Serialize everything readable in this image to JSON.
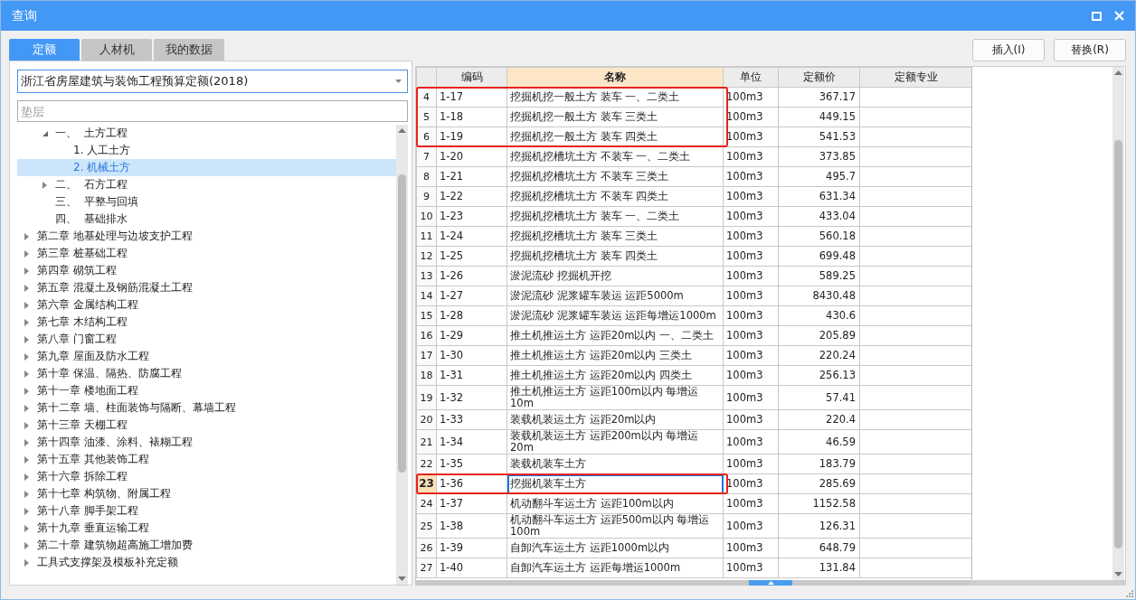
{
  "window": {
    "title": "查询"
  },
  "tabs": [
    {
      "label": "定额",
      "selected": true
    },
    {
      "label": "人材机",
      "selected": false
    },
    {
      "label": "我的数据",
      "selected": false
    }
  ],
  "library_select": {
    "value": "浙江省房屋建筑与装饰工程预算定额(2018)"
  },
  "search": {
    "placeholder": "垫层"
  },
  "tree": {
    "items": [
      {
        "kind": "section",
        "label": "一、  土方工程",
        "expanded": true,
        "selected": false,
        "children": [
          {
            "label": "1. 人工土方",
            "selected": false
          },
          {
            "label": "2. 机械土方",
            "selected": true
          }
        ]
      },
      {
        "kind": "section",
        "label": "二、  石方工程",
        "expanded": false,
        "selected": false
      },
      {
        "kind": "section",
        "label": "三、  平整与回填",
        "selected": false
      },
      {
        "kind": "section",
        "label": "四、  基础排水",
        "selected": false
      },
      {
        "kind": "chapter",
        "label": "第二章 地基处理与边坡支护工程",
        "expanded": false,
        "selected": false
      },
      {
        "kind": "chapter",
        "label": "第三章 桩基础工程",
        "expanded": false,
        "selected": false
      },
      {
        "kind": "chapter",
        "label": "第四章 砌筑工程",
        "expanded": false,
        "selected": false
      },
      {
        "kind": "chapter",
        "label": "第五章 混凝土及钢筋混凝土工程",
        "expanded": false,
        "selected": false
      },
      {
        "kind": "chapter",
        "label": "第六章 金属结构工程",
        "expanded": false,
        "selected": false
      },
      {
        "kind": "chapter",
        "label": "第七章 木结构工程",
        "expanded": false,
        "selected": false
      },
      {
        "kind": "chapter",
        "label": "第八章 门窗工程",
        "expanded": false,
        "selected": false
      },
      {
        "kind": "chapter",
        "label": "第九章 屋面及防水工程",
        "expanded": false,
        "selected": false
      },
      {
        "kind": "chapter",
        "label": "第十章 保温、隔热、防腐工程",
        "expanded": false,
        "selected": false
      },
      {
        "kind": "chapter",
        "label": "第十一章 楼地面工程",
        "expanded": false,
        "selected": false
      },
      {
        "kind": "chapter",
        "label": "第十二章 墙、柱面装饰与隔断、幕墙工程",
        "expanded": false,
        "selected": false
      },
      {
        "kind": "chapter",
        "label": "第十三章 天棚工程",
        "expanded": false,
        "selected": false
      },
      {
        "kind": "chapter",
        "label": "第十四章 油漆、涂料、裱糊工程",
        "expanded": false,
        "selected": false
      },
      {
        "kind": "chapter",
        "label": "第十五章 其他装饰工程",
        "expanded": false,
        "selected": false
      },
      {
        "kind": "chapter",
        "label": "第十六章 拆除工程",
        "expanded": false,
        "selected": false
      },
      {
        "kind": "chapter",
        "label": "第十七章 构筑物、附属工程",
        "expanded": false,
        "selected": false
      },
      {
        "kind": "chapter",
        "label": "第十八章 脚手架工程",
        "expanded": false,
        "selected": false
      },
      {
        "kind": "chapter",
        "label": "第十九章 垂直运输工程",
        "expanded": false,
        "selected": false
      },
      {
        "kind": "chapter",
        "label": "第二十章 建筑物超高施工增加费",
        "expanded": false,
        "selected": false
      },
      {
        "kind": "chapter",
        "label": "工具式支撑架及模板补充定额",
        "expanded": false,
        "selected": false
      }
    ]
  },
  "buttons": [
    "插入(I)",
    "替换(R)"
  ],
  "table": {
    "columns": [
      {
        "label": "编码",
        "selected": false
      },
      {
        "label": "名称",
        "selected": true
      },
      {
        "label": "单位",
        "selected": false
      },
      {
        "label": "定额价",
        "selected": false
      },
      {
        "label": "定额专业",
        "selected": false
      }
    ],
    "rows": [
      {
        "number": "4",
        "code": "1-17",
        "name": "挖掘机挖一般土方 装车 一、二类土",
        "unit": "100m3",
        "price": "367.17",
        "selected": false,
        "outlined": true
      },
      {
        "number": "5",
        "code": "1-18",
        "name": "挖掘机挖一般土方 装车 三类土",
        "unit": "100m3",
        "price": "449.15",
        "selected": false,
        "outlined": true
      },
      {
        "number": "6",
        "code": "1-19",
        "name": "挖掘机挖一般土方 装车 四类土",
        "unit": "100m3",
        "price": "541.53",
        "selected": false,
        "outlined": true
      },
      {
        "number": "7",
        "code": "1-20",
        "name": "挖掘机挖槽坑土方 不装车 一、二类土",
        "unit": "100m3",
        "price": "373.85",
        "selected": false,
        "outlined": false
      },
      {
        "number": "8",
        "code": "1-21",
        "name": "挖掘机挖槽坑土方 不装车 三类土",
        "unit": "100m3",
        "price": "495.7",
        "selected": false,
        "outlined": false
      },
      {
        "number": "9",
        "code": "1-22",
        "name": "挖掘机挖槽坑土方 不装车 四类土",
        "unit": "100m3",
        "price": "631.34",
        "selected": false,
        "outlined": false
      },
      {
        "number": "10",
        "code": "1-23",
        "name": "挖掘机挖槽坑土方 装车 一、二类土",
        "unit": "100m3",
        "price": "433.04",
        "selected": false,
        "outlined": false
      },
      {
        "number": "11",
        "code": "1-24",
        "name": "挖掘机挖槽坑土方 装车 三类土",
        "unit": "100m3",
        "price": "560.18",
        "selected": false,
        "outlined": false
      },
      {
        "number": "12",
        "code": "1-25",
        "name": "挖掘机挖槽坑土方 装车 四类土",
        "unit": "100m3",
        "price": "699.48",
        "selected": false,
        "outlined": false
      },
      {
        "number": "13",
        "code": "1-26",
        "name": "淤泥流砂 挖掘机开挖",
        "unit": "100m3",
        "price": "589.25",
        "selected": false,
        "outlined": false
      },
      {
        "number": "14",
        "code": "1-27",
        "name": "淤泥流砂 泥浆罐车装运 运距5000m",
        "unit": "100m3",
        "price": "8430.48",
        "selected": false,
        "outlined": false
      },
      {
        "number": "15",
        "code": "1-28",
        "name": "淤泥流砂 泥浆罐车装运 运距每增运1000m",
        "unit": "100m3",
        "price": "430.6",
        "selected": false,
        "outlined": false
      },
      {
        "number": "16",
        "code": "1-29",
        "name": "推土机推运土方 运距20m以内 一、二类土",
        "unit": "100m3",
        "price": "205.89",
        "selected": false,
        "outlined": false
      },
      {
        "number": "17",
        "code": "1-30",
        "name": "推土机推运土方 运距20m以内 三类土",
        "unit": "100m3",
        "price": "220.24",
        "selected": false,
        "outlined": false
      },
      {
        "number": "18",
        "code": "1-31",
        "name": "推土机推运土方 运距20m以内 四类土",
        "unit": "100m3",
        "price": "256.13",
        "selected": false,
        "outlined": false
      },
      {
        "number": "19",
        "code": "1-32",
        "name": "推土机推运土方 运距100m以内 每增运10m",
        "unit": "100m3",
        "price": "57.41",
        "selected": false,
        "outlined": false
      },
      {
        "number": "20",
        "code": "1-33",
        "name": "装载机装运土方 运距20m以内",
        "unit": "100m3",
        "price": "220.4",
        "selected": false,
        "outlined": false
      },
      {
        "number": "21",
        "code": "1-34",
        "name": "装载机装运土方 运距200m以内 每增运20m",
        "unit": "100m3",
        "price": "46.59",
        "selected": false,
        "outlined": false
      },
      {
        "number": "22",
        "code": "1-35",
        "name": "装载机装车土方",
        "unit": "100m3",
        "price": "183.79",
        "selected": false,
        "outlined": false
      },
      {
        "number": "23",
        "code": "1-36",
        "name": "挖掘机装车土方",
        "unit": "100m3",
        "price": "285.69",
        "selected": true,
        "outlined": true
      },
      {
        "number": "24",
        "code": "1-37",
        "name": "机动翻斗车运土方 运距100m以内",
        "unit": "100m3",
        "price": "1152.58",
        "selected": false,
        "outlined": false
      },
      {
        "number": "25",
        "code": "1-38",
        "name": "机动翻斗车运土方 运距500m以内 每增运100m",
        "unit": "100m3",
        "price": "126.31",
        "selected": false,
        "outlined": false
      },
      {
        "number": "26",
        "code": "1-39",
        "name": "自卸汽车运土方 运距1000m以内",
        "unit": "100m3",
        "price": "648.79",
        "selected": false,
        "outlined": false
      },
      {
        "number": "27",
        "code": "1-40",
        "name": "自卸汽车运土方 运距每增运1000m",
        "unit": "100m3",
        "price": "131.84",
        "selected": false,
        "outlined": false
      }
    ]
  }
}
